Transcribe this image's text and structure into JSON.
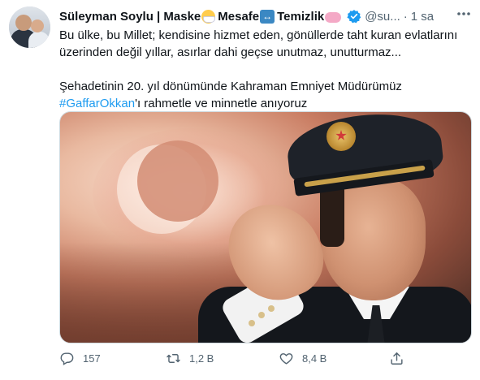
{
  "tweet": {
    "author_name": "Süleyman Soylu | Maske",
    "name_part2": "Mesafe",
    "name_part3": "Temizlik",
    "handle": "@su...",
    "dot": "·",
    "time": "1 sa",
    "text_line1": "Bu ülke, bu Millet; kendisine hizmet eden, gönüllerde taht kuran evlatlarını",
    "text_line2": "üzerinden değil yıllar, asırlar dahi geçse unutmaz, unutturmaz...",
    "text_line3": "Şehadetinin 20. yıl dönümünde Kahraman Emniyet Müdürümüz",
    "hashtag": "#GaffarOkkan",
    "text_line4_rest": "'ı rahmetle ve minnetle anıyoruz"
  },
  "icons": {
    "more": "more-icon",
    "verified": "verified-badge-icon",
    "reply": "reply-icon",
    "retweet": "retweet-icon",
    "like": "like-icon",
    "share": "share-icon"
  },
  "actions": {
    "reply_count": "157",
    "retweet_count": "1,2 B",
    "like_count": "8,4 B"
  },
  "colors": {
    "link": "#1d9bf0",
    "secondary_text": "#536471",
    "verified": "#1d9bf0"
  }
}
